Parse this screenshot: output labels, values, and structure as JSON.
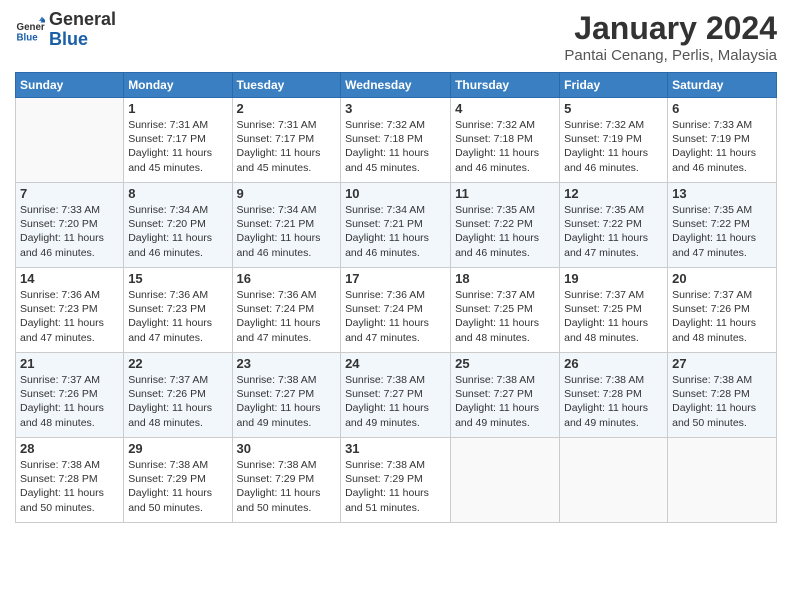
{
  "header": {
    "logo": {
      "general": "General",
      "blue": "Blue"
    },
    "title": "January 2024",
    "location": "Pantai Cenang, Perlis, Malaysia"
  },
  "days_of_week": [
    "Sunday",
    "Monday",
    "Tuesday",
    "Wednesday",
    "Thursday",
    "Friday",
    "Saturday"
  ],
  "weeks": [
    [
      {
        "day": "",
        "info": ""
      },
      {
        "day": "1",
        "info": "Sunrise: 7:31 AM\nSunset: 7:17 PM\nDaylight: 11 hours and 45 minutes."
      },
      {
        "day": "2",
        "info": "Sunrise: 7:31 AM\nSunset: 7:17 PM\nDaylight: 11 hours and 45 minutes."
      },
      {
        "day": "3",
        "info": "Sunrise: 7:32 AM\nSunset: 7:18 PM\nDaylight: 11 hours and 45 minutes."
      },
      {
        "day": "4",
        "info": "Sunrise: 7:32 AM\nSunset: 7:18 PM\nDaylight: 11 hours and 46 minutes."
      },
      {
        "day": "5",
        "info": "Sunrise: 7:32 AM\nSunset: 7:19 PM\nDaylight: 11 hours and 46 minutes."
      },
      {
        "day": "6",
        "info": "Sunrise: 7:33 AM\nSunset: 7:19 PM\nDaylight: 11 hours and 46 minutes."
      }
    ],
    [
      {
        "day": "7",
        "info": "Sunrise: 7:33 AM\nSunset: 7:20 PM\nDaylight: 11 hours and 46 minutes."
      },
      {
        "day": "8",
        "info": "Sunrise: 7:34 AM\nSunset: 7:20 PM\nDaylight: 11 hours and 46 minutes."
      },
      {
        "day": "9",
        "info": "Sunrise: 7:34 AM\nSunset: 7:21 PM\nDaylight: 11 hours and 46 minutes."
      },
      {
        "day": "10",
        "info": "Sunrise: 7:34 AM\nSunset: 7:21 PM\nDaylight: 11 hours and 46 minutes."
      },
      {
        "day": "11",
        "info": "Sunrise: 7:35 AM\nSunset: 7:22 PM\nDaylight: 11 hours and 46 minutes."
      },
      {
        "day": "12",
        "info": "Sunrise: 7:35 AM\nSunset: 7:22 PM\nDaylight: 11 hours and 47 minutes."
      },
      {
        "day": "13",
        "info": "Sunrise: 7:35 AM\nSunset: 7:22 PM\nDaylight: 11 hours and 47 minutes."
      }
    ],
    [
      {
        "day": "14",
        "info": "Sunrise: 7:36 AM\nSunset: 7:23 PM\nDaylight: 11 hours and 47 minutes."
      },
      {
        "day": "15",
        "info": "Sunrise: 7:36 AM\nSunset: 7:23 PM\nDaylight: 11 hours and 47 minutes."
      },
      {
        "day": "16",
        "info": "Sunrise: 7:36 AM\nSunset: 7:24 PM\nDaylight: 11 hours and 47 minutes."
      },
      {
        "day": "17",
        "info": "Sunrise: 7:36 AM\nSunset: 7:24 PM\nDaylight: 11 hours and 47 minutes."
      },
      {
        "day": "18",
        "info": "Sunrise: 7:37 AM\nSunset: 7:25 PM\nDaylight: 11 hours and 48 minutes."
      },
      {
        "day": "19",
        "info": "Sunrise: 7:37 AM\nSunset: 7:25 PM\nDaylight: 11 hours and 48 minutes."
      },
      {
        "day": "20",
        "info": "Sunrise: 7:37 AM\nSunset: 7:26 PM\nDaylight: 11 hours and 48 minutes."
      }
    ],
    [
      {
        "day": "21",
        "info": "Sunrise: 7:37 AM\nSunset: 7:26 PM\nDaylight: 11 hours and 48 minutes."
      },
      {
        "day": "22",
        "info": "Sunrise: 7:37 AM\nSunset: 7:26 PM\nDaylight: 11 hours and 48 minutes."
      },
      {
        "day": "23",
        "info": "Sunrise: 7:38 AM\nSunset: 7:27 PM\nDaylight: 11 hours and 49 minutes."
      },
      {
        "day": "24",
        "info": "Sunrise: 7:38 AM\nSunset: 7:27 PM\nDaylight: 11 hours and 49 minutes."
      },
      {
        "day": "25",
        "info": "Sunrise: 7:38 AM\nSunset: 7:27 PM\nDaylight: 11 hours and 49 minutes."
      },
      {
        "day": "26",
        "info": "Sunrise: 7:38 AM\nSunset: 7:28 PM\nDaylight: 11 hours and 49 minutes."
      },
      {
        "day": "27",
        "info": "Sunrise: 7:38 AM\nSunset: 7:28 PM\nDaylight: 11 hours and 50 minutes."
      }
    ],
    [
      {
        "day": "28",
        "info": "Sunrise: 7:38 AM\nSunset: 7:28 PM\nDaylight: 11 hours and 50 minutes."
      },
      {
        "day": "29",
        "info": "Sunrise: 7:38 AM\nSunset: 7:29 PM\nDaylight: 11 hours and 50 minutes."
      },
      {
        "day": "30",
        "info": "Sunrise: 7:38 AM\nSunset: 7:29 PM\nDaylight: 11 hours and 50 minutes."
      },
      {
        "day": "31",
        "info": "Sunrise: 7:38 AM\nSunset: 7:29 PM\nDaylight: 11 hours and 51 minutes."
      },
      {
        "day": "",
        "info": ""
      },
      {
        "day": "",
        "info": ""
      },
      {
        "day": "",
        "info": ""
      }
    ]
  ]
}
